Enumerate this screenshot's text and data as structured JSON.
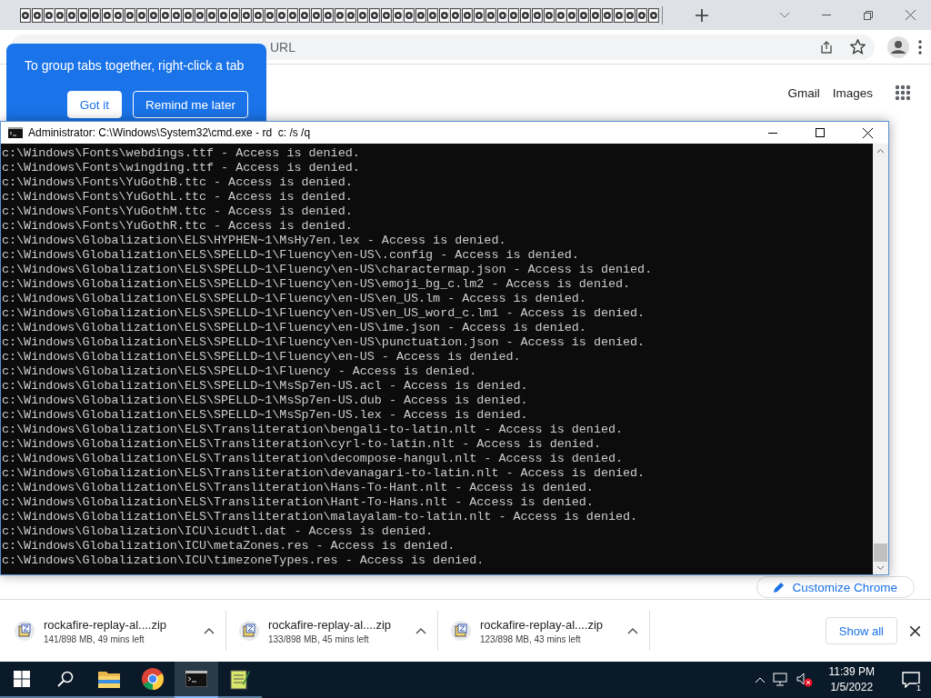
{
  "browser": {
    "address_text": "URL",
    "links": [
      "Gmail",
      "Images"
    ],
    "customize_button": "Customize Chrome"
  },
  "tab_group_tip": {
    "message": "To group tabs together, right-click a tab",
    "buttons": [
      "Got it",
      "Remind me later"
    ]
  },
  "console": {
    "title": "Administrator: C:\\Windows\\System32\\cmd.exe - rd  c: /s /q",
    "lines": [
      "c:\\Windows\\Fonts\\webdings.ttf - Access is denied.",
      "c:\\Windows\\Fonts\\wingding.ttf - Access is denied.",
      "c:\\Windows\\Fonts\\YuGothB.ttc - Access is denied.",
      "c:\\Windows\\Fonts\\YuGothL.ttc - Access is denied.",
      "c:\\Windows\\Fonts\\YuGothM.ttc - Access is denied.",
      "c:\\Windows\\Fonts\\YuGothR.ttc - Access is denied.",
      "c:\\Windows\\Globalization\\ELS\\HYPHEN~1\\MsHy7en.lex - Access is denied.",
      "c:\\Windows\\Globalization\\ELS\\SPELLD~1\\Fluency\\en-US\\.config - Access is denied.",
      "c:\\Windows\\Globalization\\ELS\\SPELLD~1\\Fluency\\en-US\\charactermap.json - Access is denied.",
      "c:\\Windows\\Globalization\\ELS\\SPELLD~1\\Fluency\\en-US\\emoji_bg_c.lm2 - Access is denied.",
      "c:\\Windows\\Globalization\\ELS\\SPELLD~1\\Fluency\\en-US\\en_US.lm - Access is denied.",
      "c:\\Windows\\Globalization\\ELS\\SPELLD~1\\Fluency\\en-US\\en_US_word_c.lm1 - Access is denied.",
      "c:\\Windows\\Globalization\\ELS\\SPELLD~1\\Fluency\\en-US\\ime.json - Access is denied.",
      "c:\\Windows\\Globalization\\ELS\\SPELLD~1\\Fluency\\en-US\\punctuation.json - Access is denied.",
      "c:\\Windows\\Globalization\\ELS\\SPELLD~1\\Fluency\\en-US - Access is denied.",
      "c:\\Windows\\Globalization\\ELS\\SPELLD~1\\Fluency - Access is denied.",
      "c:\\Windows\\Globalization\\ELS\\SPELLD~1\\MsSp7en-US.acl - Access is denied.",
      "c:\\Windows\\Globalization\\ELS\\SPELLD~1\\MsSp7en-US.dub - Access is denied.",
      "c:\\Windows\\Globalization\\ELS\\SPELLD~1\\MsSp7en-US.lex - Access is denied.",
      "c:\\Windows\\Globalization\\ELS\\Transliteration\\bengali-to-latin.nlt - Access is denied.",
      "c:\\Windows\\Globalization\\ELS\\Transliteration\\cyrl-to-latin.nlt - Access is denied.",
      "c:\\Windows\\Globalization\\ELS\\Transliteration\\decompose-hangul.nlt - Access is denied.",
      "c:\\Windows\\Globalization\\ELS\\Transliteration\\devanagari-to-latin.nlt - Access is denied.",
      "c:\\Windows\\Globalization\\ELS\\Transliteration\\Hans-To-Hant.nlt - Access is denied.",
      "c:\\Windows\\Globalization\\ELS\\Transliteration\\Hant-To-Hans.nlt - Access is denied.",
      "c:\\Windows\\Globalization\\ELS\\Transliteration\\malayalam-to-latin.nlt - Access is denied.",
      "c:\\Windows\\Globalization\\ICU\\icudtl.dat - Access is denied.",
      "c:\\Windows\\Globalization\\ICU\\metaZones.res - Access is denied.",
      "c:\\Windows\\Globalization\\ICU\\timezoneTypes.res - Access is denied."
    ]
  },
  "downloads": {
    "items": [
      {
        "name": "rockafire-replay-al....zip",
        "status": "141/898 MB, 49 mins left"
      },
      {
        "name": "rockafire-replay-al....zip",
        "status": "133/898 MB, 45 mins left"
      },
      {
        "name": "rockafire-replay-al....zip",
        "status": "123/898 MB, 43 mins left"
      }
    ],
    "show_all": "Show all"
  },
  "taskbar": {
    "apps": [
      {
        "kind": "folder",
        "selected": false
      },
      {
        "kind": "chrome",
        "selected": false
      },
      {
        "kind": "console",
        "selected": true
      },
      {
        "kind": "notepad",
        "selected": false
      }
    ],
    "time": "11:39 PM",
    "date": "1/5/2022",
    "notifications": "1"
  }
}
